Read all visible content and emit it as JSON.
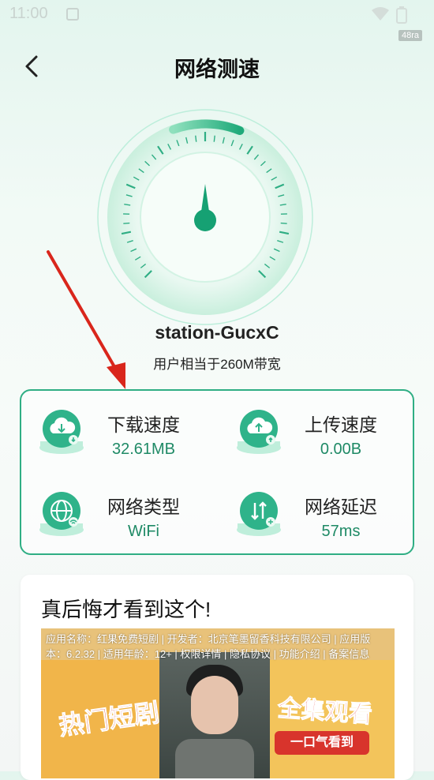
{
  "status_bar": {
    "time": "11:00",
    "tag": "48ra"
  },
  "header": {
    "title": "网络测速",
    "back_icon": "chevron-left-icon"
  },
  "gauge": {
    "progress_fraction": 0.25,
    "needle_icon": "needle-icon",
    "accent_color": "#1faa7a"
  },
  "network": {
    "ssid": "station-GucxC",
    "bandwidth_text": "用户相当于260M带宽"
  },
  "stats": [
    {
      "label": "下载速度",
      "value": "32.61MB",
      "icon": "cloud-download-icon"
    },
    {
      "label": "上传速度",
      "value": "0.00B",
      "icon": "cloud-upload-icon"
    },
    {
      "label": "网络类型",
      "value": "WiFi",
      "icon": "globe-icon"
    },
    {
      "label": "网络延迟",
      "value": "57ms",
      "icon": "latency-icon"
    }
  ],
  "ad": {
    "title": "真后悔才看到这个!",
    "meta_text": "应用名称：红果免费短剧 | 开发者：北京笔墨留香科技有限公司 | 应用版本：6.2.32 | 适用年龄：12+ | 权限详情 | 隐私协议 | 功能介绍 | 备案信息",
    "left_art_text": "热门短剧",
    "right_art_text": "全集观看",
    "right_banner_text": "一口气看到"
  },
  "colors": {
    "accent": "#2fae84",
    "value_text": "#1f8a66",
    "annotation_arrow": "#d9261c"
  }
}
